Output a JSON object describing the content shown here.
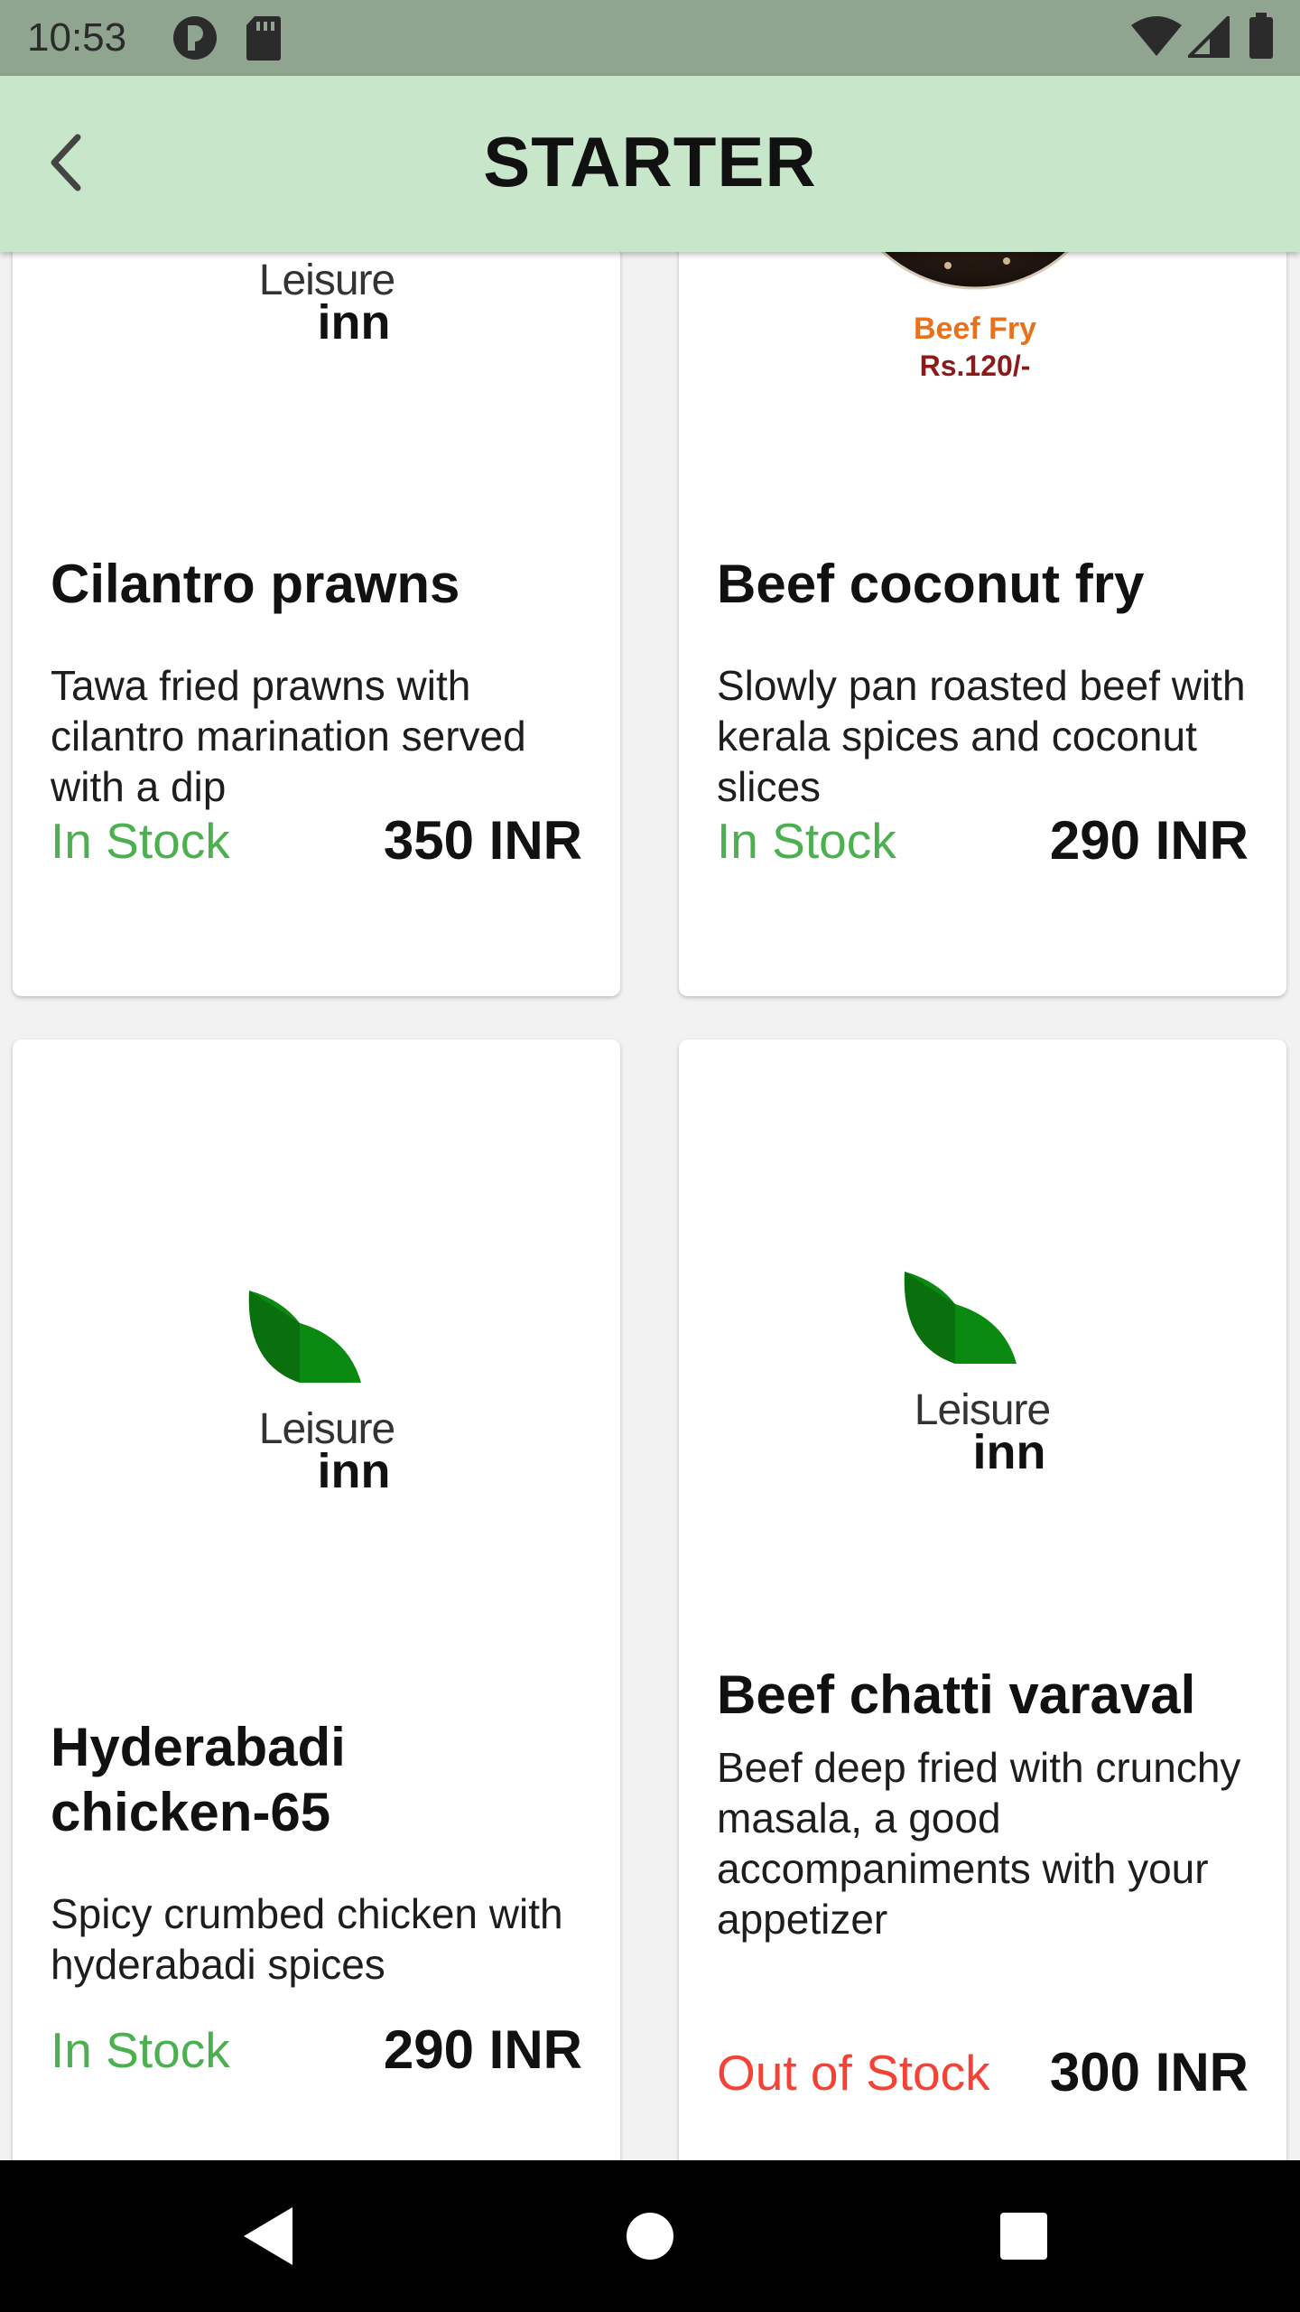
{
  "status_bar": {
    "time": "10:53"
  },
  "app_bar": {
    "title": "STARTER",
    "back_icon": "chevron-left-icon"
  },
  "logo": {
    "line1": "Leisure",
    "line2": "inn",
    "color_light": "#0a8a10",
    "color_dark": "#0c4f0c"
  },
  "items": [
    {
      "name": "Cilantro prawns",
      "description": "Tawa fried prawns with cilantro marination served with a dip",
      "stock": "In Stock",
      "price": "350 INR",
      "image": "leisure-inn-logo"
    },
    {
      "name": "Beef coconut fry",
      "description": "Slowly pan roasted beef with kerala spices and coconut slices",
      "stock": "In Stock",
      "price": "290 INR",
      "image": "beef-fry-photo",
      "image_caption_line1": "Beef Fry",
      "image_caption_line2": "Rs.120/-"
    },
    {
      "name": "Hyderabadi chicken-65",
      "description": "Spicy crumbed chicken with hyderabadi spices",
      "stock": "In Stock",
      "price": "290 INR",
      "image": "leisure-inn-logo"
    },
    {
      "name": "Beef chatti varaval",
      "description": "Beef deep fried with crunchy masala, a good accompaniments with your appetizer",
      "stock": "Out of Stock",
      "price": "300 INR",
      "image": "leisure-inn-logo"
    }
  ],
  "colors": {
    "in_stock": "#4caf50",
    "out_of_stock": "#f44336",
    "app_bar": "#c8e6c9",
    "status_bar": "#8fa58f",
    "caption_orange": "#e8711c",
    "caption_red": "#8b1a1a"
  },
  "nav_bar": {
    "back_icon": "triangle-back-icon",
    "home_icon": "circle-home-icon",
    "recents_icon": "square-recents-icon"
  }
}
